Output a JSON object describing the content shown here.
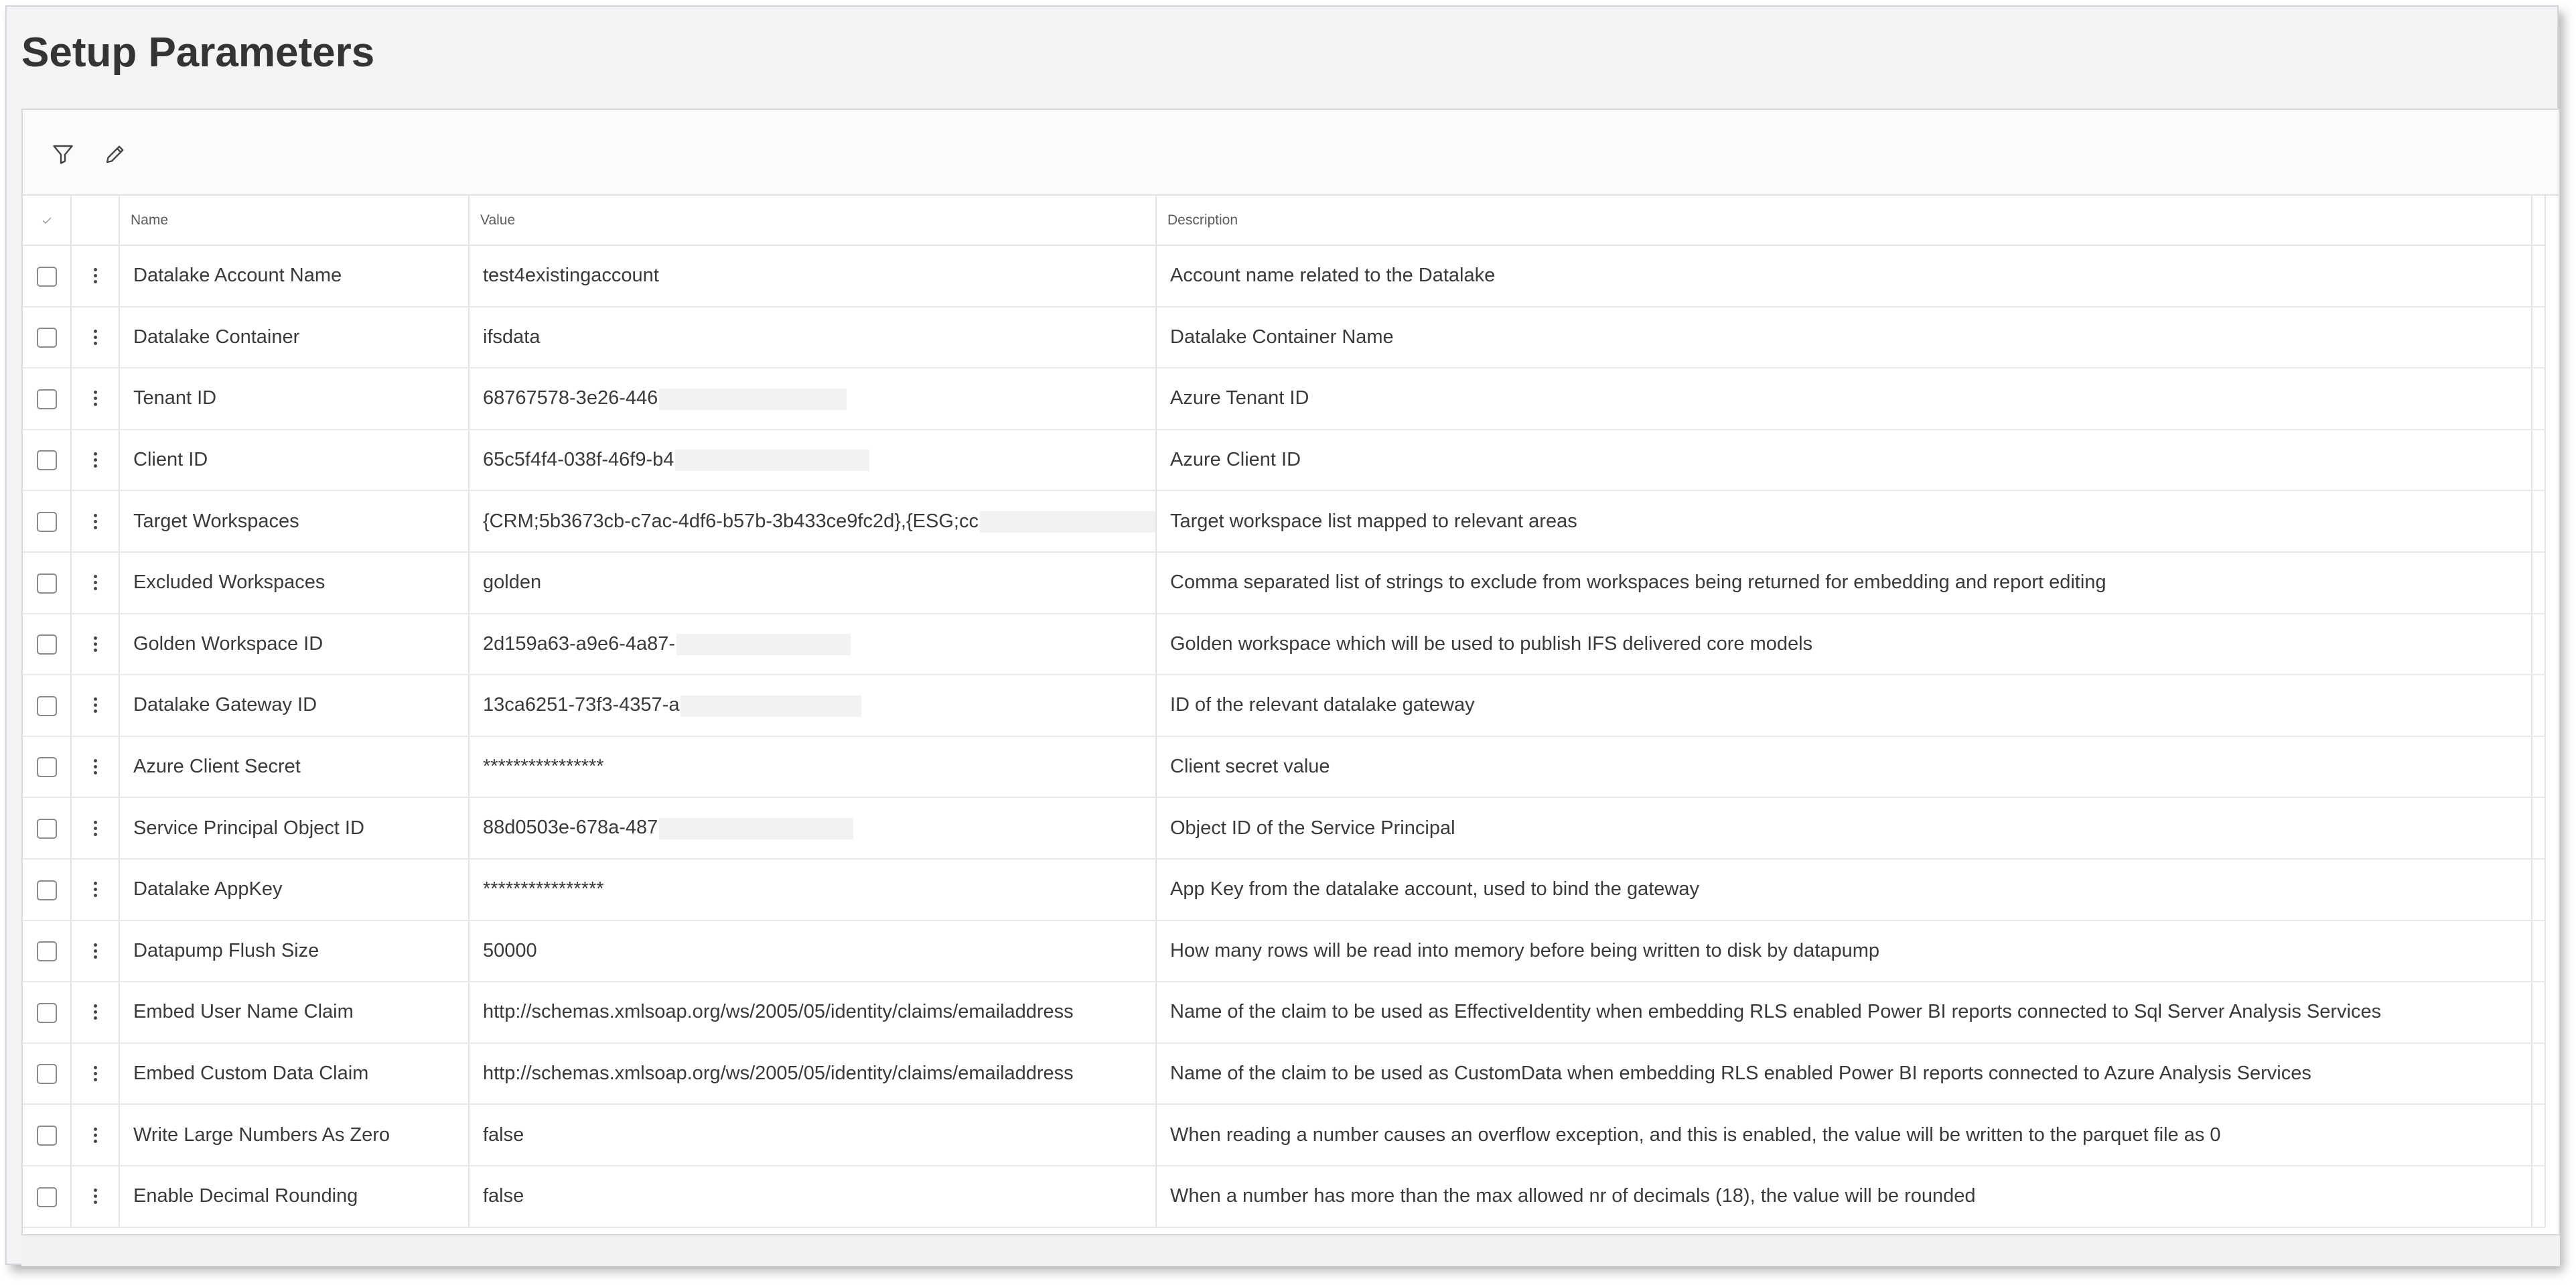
{
  "page": {
    "title": "Setup Parameters"
  },
  "toolbar": {
    "filter_icon": "filter-icon",
    "edit_icon": "pencil-icon"
  },
  "columns": {
    "name": "Name",
    "value": "Value",
    "description": "Description"
  },
  "rows": [
    {
      "name": "Datalake Account Name",
      "value": "test4existingaccount",
      "description": "Account name related to the Datalake"
    },
    {
      "name": "Datalake Container",
      "value": "ifsdata",
      "description": "Datalake Container Name"
    },
    {
      "name": "Tenant ID",
      "value": "68767578-3e26-446",
      "description": "Azure Tenant ID"
    },
    {
      "name": "Client ID",
      "value": "65c5f4f4-038f-46f9-b4",
      "description": "Azure Client ID"
    },
    {
      "name": "Target Workspaces",
      "value": "{CRM;5b3673cb-c7ac-4df6-b57b-3b433ce9fc2d},{ESG;cc",
      "description": "Target workspace list mapped to relevant areas"
    },
    {
      "name": "Excluded Workspaces",
      "value": "golden",
      "description": "Comma separated list of strings to exclude from workspaces being returned for embedding and report editing"
    },
    {
      "name": "Golden Workspace ID",
      "value": "2d159a63-a9e6-4a87-",
      "description": "Golden workspace which will be used to publish IFS delivered core models"
    },
    {
      "name": "Datalake Gateway ID",
      "value": "13ca6251-73f3-4357-a",
      "description": "ID of the relevant datalake gateway"
    },
    {
      "name": "Azure Client Secret",
      "value": "****************",
      "description": "Client secret value"
    },
    {
      "name": "Service Principal Object ID",
      "value": "88d0503e-678a-487",
      "description": "Object ID of the Service Principal"
    },
    {
      "name": "Datalake AppKey",
      "value": "****************",
      "description": "App Key from the datalake account, used to bind the gateway"
    },
    {
      "name": "Datapump Flush Size",
      "value": "50000",
      "description": "How many rows will be read into memory before being written to disk by datapump"
    },
    {
      "name": "Embed User Name Claim",
      "value": "http://schemas.xmlsoap.org/ws/2005/05/identity/claims/emailaddress",
      "description": "Name of the claim to be used as EffectiveIdentity when embedding RLS enabled Power BI reports connected to Sql Server Analysis Services"
    },
    {
      "name": "Embed Custom Data Claim",
      "value": "http://schemas.xmlsoap.org/ws/2005/05/identity/claims/emailaddress",
      "description": "Name of the claim to be used as CustomData when embedding RLS enabled Power BI reports connected to Azure Analysis Services"
    },
    {
      "name": "Write Large Numbers As Zero",
      "value": "false",
      "description": "When reading a number causes an overflow exception, and this is enabled, the value will be written to the parquet file as 0"
    },
    {
      "name": "Enable Decimal Rounding",
      "value": "false",
      "description": "When a number has more than the max allowed nr of decimals (18), the value will be rounded"
    }
  ],
  "colors": {
    "background": "#f4f3f6",
    "panel": "#ffffff",
    "border": "#e4e4e7",
    "text": "#3a3a3a",
    "title": "#343434"
  }
}
